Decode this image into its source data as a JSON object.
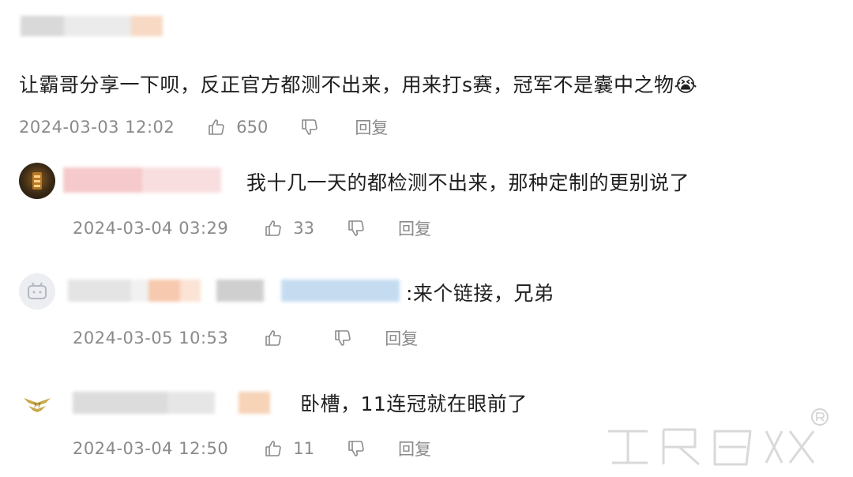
{
  "comments": [
    {
      "text": "让霸哥分享一下呗，反正官方都测不出来，用来打s赛，冠军不是囊中之物😭",
      "time": "2024-03-03 12:02",
      "likes": "650",
      "reply_label": "回复"
    },
    {
      "text": "我十几一天的都检测不出来，那种定制的更别说了",
      "time": "2024-03-04 03:29",
      "likes": "33",
      "reply_label": "回复"
    },
    {
      "text": ":来个链接，兄弟",
      "time": "2024-03-05 10:53",
      "likes": "",
      "reply_label": "回复"
    },
    {
      "text": "卧槽，11连冠就在眼前了",
      "time": "2024-03-04 12:50",
      "likes": "11",
      "reply_label": "回复"
    }
  ],
  "icons": {
    "like": "thumbs-up-icon",
    "dislike": "thumbs-down-icon"
  },
  "colors": {
    "meta_text": "#8a8a8a",
    "body_text": "#1f1f1f"
  }
}
